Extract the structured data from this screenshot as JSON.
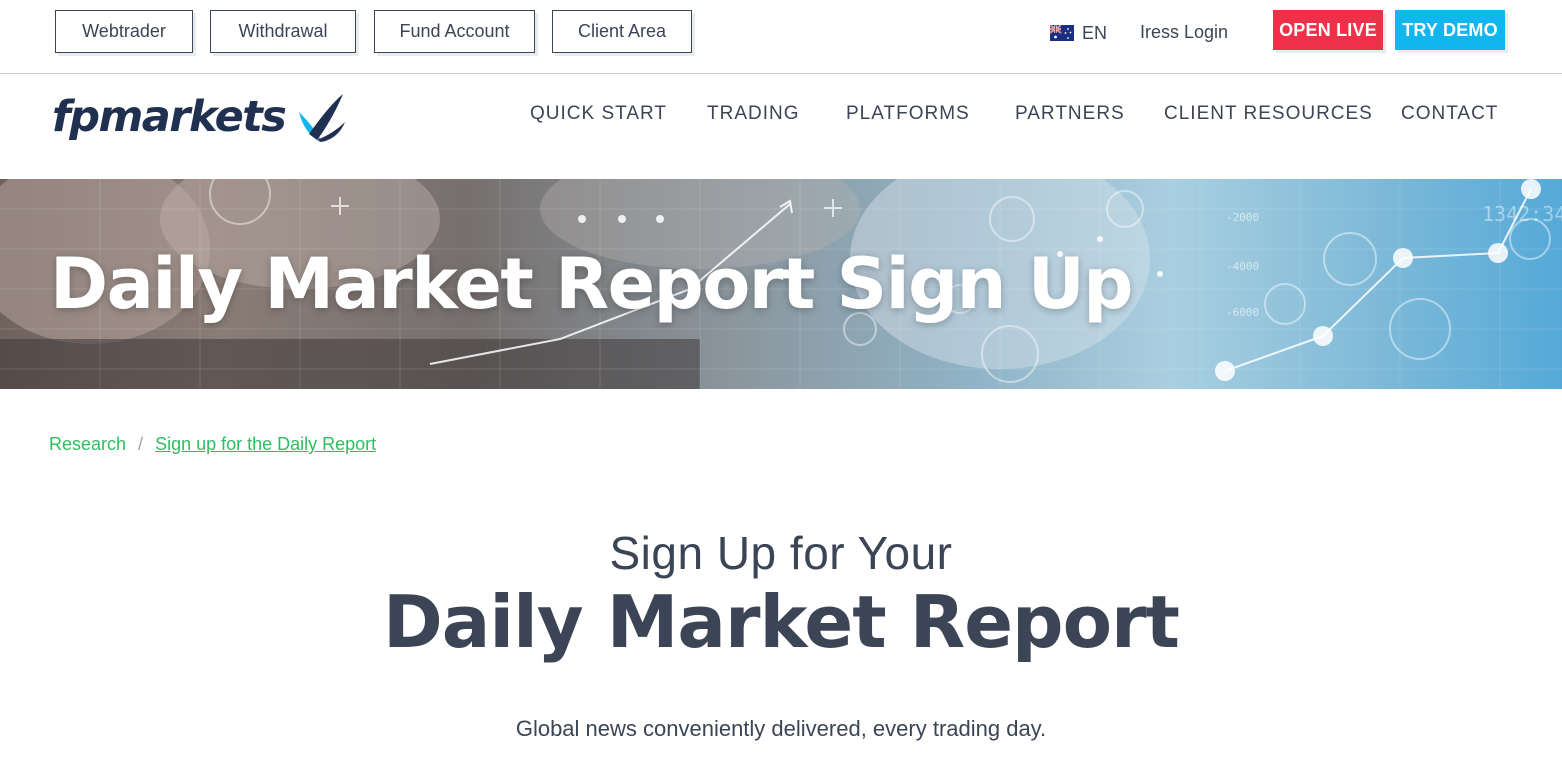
{
  "topbar": {
    "buttons": [
      "Webtrader",
      "Withdrawal",
      "Fund Account",
      "Client Area"
    ],
    "language": "EN",
    "iress_login": "Iress Login",
    "open_live": "OPEN LIVE",
    "try_demo": "TRY DEMO"
  },
  "header": {
    "logo_text": "fpmarkets",
    "nav": [
      "QUICK START",
      "TRADING",
      "PLATFORMS",
      "PARTNERS",
      "CLIENT RESOURCES",
      "CONTACT"
    ]
  },
  "hero": {
    "title": "Daily Market Report Sign Up",
    "decor_labels": [
      "1342:34",
      "-2000",
      "-4000",
      "-6000"
    ]
  },
  "breadcrumb": {
    "items": [
      "Research",
      "Sign up for the Daily Report"
    ]
  },
  "content": {
    "subheading": "Sign Up for Your",
    "heading": "Daily Market Report",
    "tagline": "Global news conveniently delivered, every trading day."
  },
  "colors": {
    "text_primary": "#3b4556",
    "open_live": "#ef3049",
    "try_demo": "#12b6ef",
    "breadcrumb_link": "#2dbe60",
    "logo_navy": "#1f3050"
  }
}
